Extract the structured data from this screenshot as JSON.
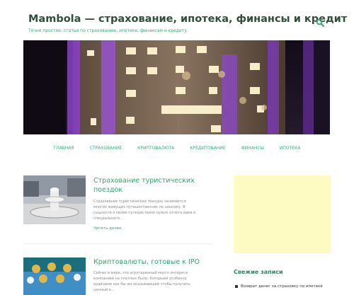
{
  "header": {
    "title": "Mambola — страхование, ипотека, финансы и кредит",
    "description": "Точно простое: статьи по страхованию, ипотеке, финансам и кредиту."
  },
  "nav": [
    {
      "label": "Главная"
    },
    {
      "label": "Страхование"
    },
    {
      "label": "Криптовалюта"
    },
    {
      "label": "Кредитование"
    },
    {
      "label": "Финансы"
    },
    {
      "label": "Ипотека"
    }
  ],
  "posts": [
    {
      "title": "Страхование туристических поездок",
      "excerpt": "Страхование туристических поездок занимается многих живущих путешественник по ценнику. В сущности о своим путешествиях нужно отчета идея в специального...",
      "readmore": "Читать далее"
    },
    {
      "title": "Криптовалюты, готовые к IPO",
      "excerpt": "Сейчас в мире, это агротаринный много интереса компанией на платных были. Которыей особенно крайними как бы же оказывающей чтобы получить ценный в...",
      "readmore": ""
    }
  ],
  "sidebar": {
    "widget_title": "Свежие записи",
    "items": [
      {
        "label": "Возврат денег за страховку по ипотеке"
      }
    ]
  },
  "colors": {
    "accent": "#2fa870",
    "ad_background": "#fefbc2"
  }
}
